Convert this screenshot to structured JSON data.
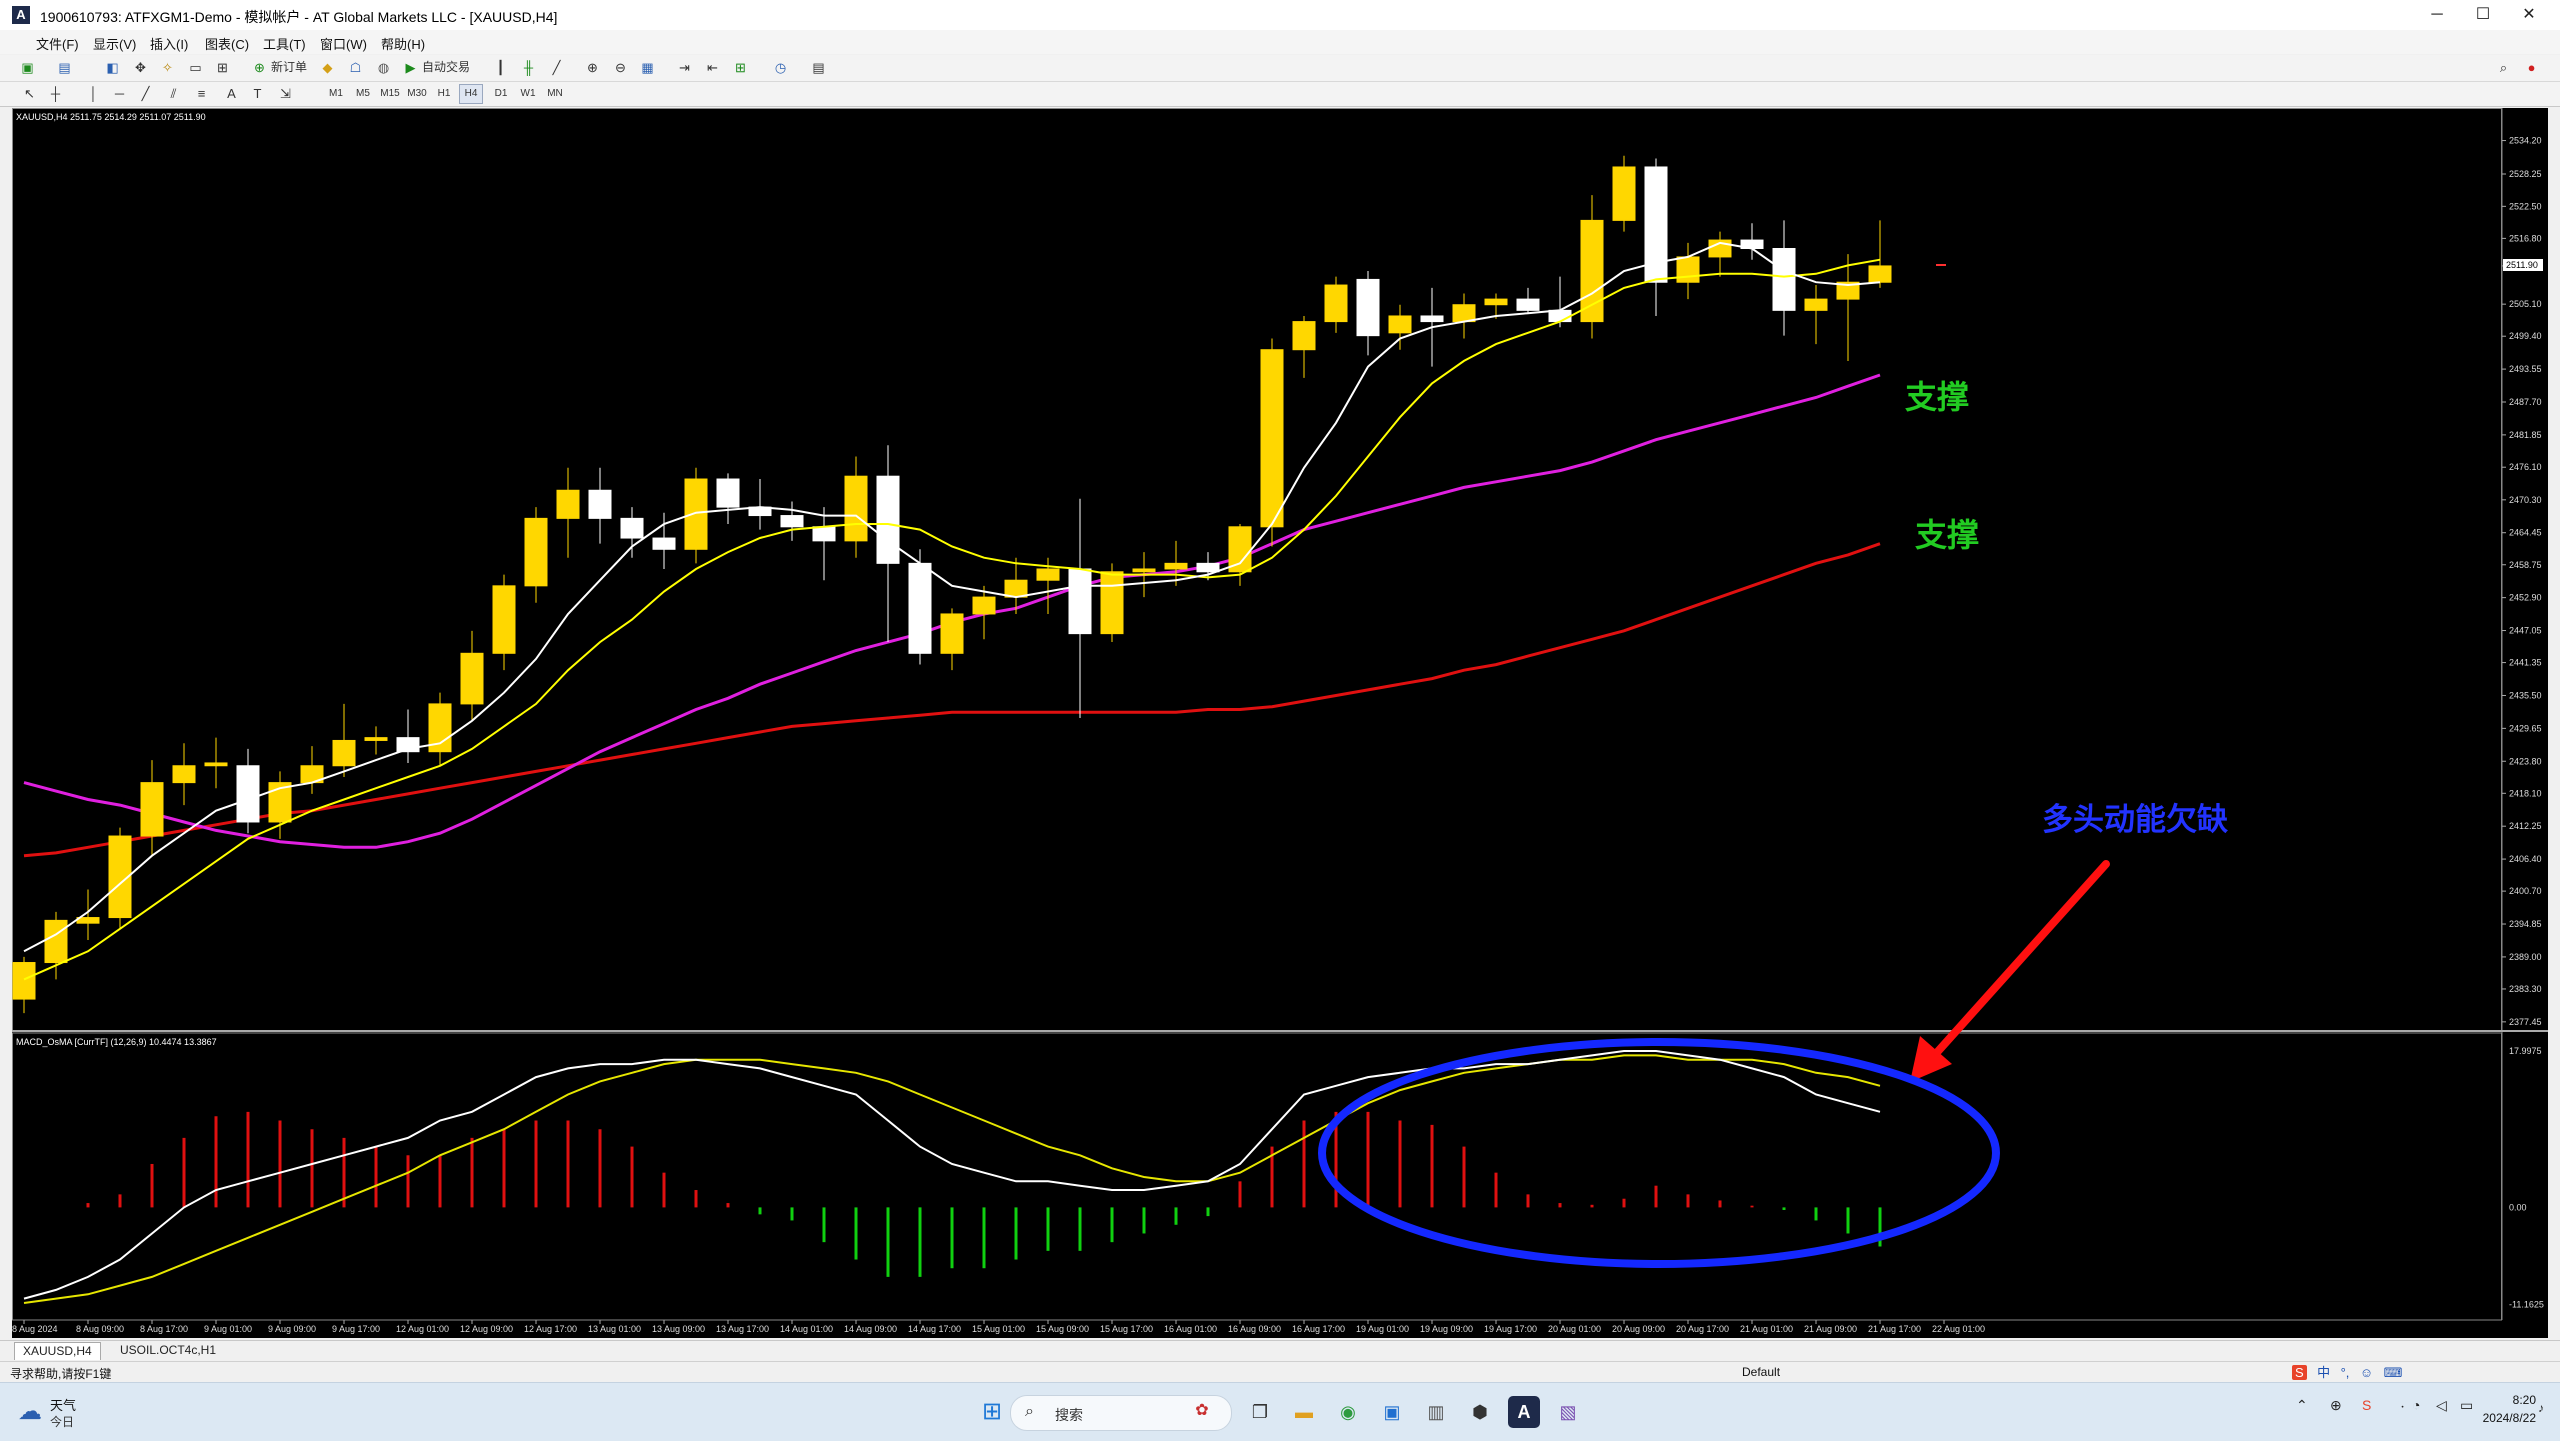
{
  "window": {
    "title": "1900610793: ATFXGM1-Demo - 模拟帐户 - AT Global Markets LLC - [XAUUSD,H4]",
    "minimize": "─",
    "maximize": "☐",
    "close": "✕"
  },
  "menu": [
    "文件(F)",
    "显示(V)",
    "插入(I)",
    "图表(C)",
    "工具(T)",
    "窗口(W)",
    "帮助(H)"
  ],
  "toolbar": {
    "new_order": "新订单",
    "auto_trading": "自动交易"
  },
  "timeframes": [
    "M1",
    "M5",
    "M15",
    "M30",
    "H1",
    "H4",
    "D1",
    "W1",
    "MN"
  ],
  "active_timeframe": "H4",
  "chart_header": "XAUUSD,H4  2511.75 2514.29 2511.07 2511.90",
  "current_price_label": "2511.90",
  "indicator_header": "MACD_OsMA [CurrTF] (12,26,9) 10.4474 13.3867",
  "annotations": {
    "support_1": "支撑",
    "support_2": "支撑",
    "momentum_text": "多头动能欠缺"
  },
  "colors": {
    "bull_candle": "#ffd700",
    "bear_candle": "#ffffff",
    "ma_fast": "#ffffff",
    "ma_slow": "#ffff00",
    "ma_magenta": "#e020e0",
    "ma_red": "#e01010",
    "annotation_green": "#22cc22",
    "annotation_blue": "#2233ff",
    "macd_pos": "#e01010",
    "macd_neg": "#10d010"
  },
  "tabs": [
    "XAUUSD,H4",
    "USOIL.OCT4c,H1"
  ],
  "status": {
    "help": "寻求帮助,请按F1键",
    "profile": "Default"
  },
  "taskbar": {
    "weather": "天气",
    "weather_sub": "今日",
    "search_placeholder": "搜索",
    "time": "8:20",
    "date": "2024/8/22"
  },
  "ime": [
    "S",
    "中",
    "°,",
    "☺",
    "⌨"
  ],
  "chart_data": {
    "type": "candlestick",
    "symbol": "XAUUSD",
    "timeframe": "H4",
    "price_ticks": [
      2534.2,
      2528.25,
      2522.5,
      2516.8,
      2511.9,
      2505.1,
      2499.4,
      2493.55,
      2487.7,
      2481.85,
      2476.1,
      2470.3,
      2464.45,
      2458.75,
      2452.9,
      2447.05,
      2441.35,
      2435.5,
      2429.65,
      2423.8,
      2418.1,
      2412.25,
      2406.4,
      2400.7,
      2394.85,
      2389.0,
      2383.3,
      2377.45
    ],
    "ylim": [
      2376.0,
      2537.5
    ],
    "macd_ticks": [
      "17.9975",
      "0.00",
      "-11.1625"
    ],
    "macd_ylim": [
      -12.5,
      19.5
    ],
    "time_labels": [
      "8 Aug 2024",
      "8 Aug 09:00",
      "8 Aug 17:00",
      "9 Aug 01:00",
      "9 Aug 09:00",
      "9 Aug 17:00",
      "12 Aug 01:00",
      "12 Aug 09:00",
      "12 Aug 17:00",
      "13 Aug 01:00",
      "13 Aug 09:00",
      "13 Aug 17:00",
      "14 Aug 01:00",
      "14 Aug 09:00",
      "14 Aug 17:00",
      "15 Aug 01:00",
      "15 Aug 09:00",
      "15 Aug 17:00",
      "16 Aug 01:00",
      "16 Aug 09:00",
      "16 Aug 17:00",
      "19 Aug 01:00",
      "19 Aug 09:00",
      "19 Aug 17:00",
      "20 Aug 01:00",
      "20 Aug 09:00",
      "20 Aug 17:00",
      "21 Aug 01:00",
      "21 Aug 09:00",
      "21 Aug 17:00",
      "22 Aug 01:00"
    ],
    "candles": [
      {
        "o": 2381.5,
        "h": 2389.0,
        "l": 2379.0,
        "c": 2388.0
      },
      {
        "o": 2388.0,
        "h": 2397.0,
        "l": 2385.0,
        "c": 2395.5
      },
      {
        "o": 2395.0,
        "h": 2401.0,
        "l": 2392.0,
        "c": 2396.0
      },
      {
        "o": 2396.0,
        "h": 2412.0,
        "l": 2394.0,
        "c": 2410.5
      },
      {
        "o": 2410.5,
        "h": 2424.0,
        "l": 2407.0,
        "c": 2420.0
      },
      {
        "o": 2420.0,
        "h": 2427.0,
        "l": 2416.0,
        "c": 2423.0
      },
      {
        "o": 2423.0,
        "h": 2428.0,
        "l": 2419.0,
        "c": 2423.5
      },
      {
        "o": 2423.0,
        "h": 2426.0,
        "l": 2411.0,
        "c": 2413.0
      },
      {
        "o": 2413.0,
        "h": 2422.0,
        "l": 2410.0,
        "c": 2420.0
      },
      {
        "o": 2420.0,
        "h": 2426.5,
        "l": 2418.0,
        "c": 2423.0
      },
      {
        "o": 2423.0,
        "h": 2434.0,
        "l": 2421.0,
        "c": 2427.5
      },
      {
        "o": 2427.5,
        "h": 2430.0,
        "l": 2425.0,
        "c": 2428.0
      },
      {
        "o": 2428.0,
        "h": 2433.0,
        "l": 2423.5,
        "c": 2425.5
      },
      {
        "o": 2425.5,
        "h": 2436.0,
        "l": 2423.0,
        "c": 2434.0
      },
      {
        "o": 2434.0,
        "h": 2447.0,
        "l": 2431.0,
        "c": 2443.0
      },
      {
        "o": 2443.0,
        "h": 2457.0,
        "l": 2440.0,
        "c": 2455.0
      },
      {
        "o": 2455.0,
        "h": 2469.0,
        "l": 2452.0,
        "c": 2467.0
      },
      {
        "o": 2467.0,
        "h": 2476.0,
        "l": 2460.0,
        "c": 2472.0
      },
      {
        "o": 2472.0,
        "h": 2476.0,
        "l": 2462.5,
        "c": 2467.0
      },
      {
        "o": 2467.0,
        "h": 2469.0,
        "l": 2460.0,
        "c": 2463.5
      },
      {
        "o": 2463.5,
        "h": 2468.0,
        "l": 2458.0,
        "c": 2461.5
      },
      {
        "o": 2461.5,
        "h": 2476.0,
        "l": 2459.0,
        "c": 2474.0
      },
      {
        "o": 2474.0,
        "h": 2475.0,
        "l": 2466.0,
        "c": 2469.0
      },
      {
        "o": 2469.0,
        "h": 2474.0,
        "l": 2465.0,
        "c": 2467.5
      },
      {
        "o": 2467.5,
        "h": 2470.0,
        "l": 2463.0,
        "c": 2465.5
      },
      {
        "o": 2465.5,
        "h": 2469.0,
        "l": 2456.0,
        "c": 2463.0
      },
      {
        "o": 2463.0,
        "h": 2478.0,
        "l": 2460.0,
        "c": 2474.5
      },
      {
        "o": 2474.5,
        "h": 2480.0,
        "l": 2445.0,
        "c": 2459.0
      },
      {
        "o": 2459.0,
        "h": 2461.5,
        "l": 2441.0,
        "c": 2443.0
      },
      {
        "o": 2443.0,
        "h": 2451.0,
        "l": 2440.0,
        "c": 2450.0
      },
      {
        "o": 2450.0,
        "h": 2455.0,
        "l": 2445.5,
        "c": 2453.0
      },
      {
        "o": 2453.0,
        "h": 2460.0,
        "l": 2450.0,
        "c": 2456.0
      },
      {
        "o": 2456.0,
        "h": 2460.0,
        "l": 2450.0,
        "c": 2458.0
      },
      {
        "o": 2458.0,
        "h": 2470.5,
        "l": 2431.5,
        "c": 2446.5
      },
      {
        "o": 2446.5,
        "h": 2459.0,
        "l": 2445.0,
        "c": 2457.5
      },
      {
        "o": 2457.5,
        "h": 2461.0,
        "l": 2453.0,
        "c": 2458.0
      },
      {
        "o": 2458.0,
        "h": 2463.0,
        "l": 2455.0,
        "c": 2459.0
      },
      {
        "o": 2459.0,
        "h": 2461.0,
        "l": 2456.0,
        "c": 2457.5
      },
      {
        "o": 2457.5,
        "h": 2466.0,
        "l": 2455.0,
        "c": 2465.5
      },
      {
        "o": 2465.5,
        "h": 2499.0,
        "l": 2462.0,
        "c": 2497.0
      },
      {
        "o": 2497.0,
        "h": 2503.0,
        "l": 2492.0,
        "c": 2502.0
      },
      {
        "o": 2502.0,
        "h": 2510.0,
        "l": 2500.0,
        "c": 2508.5
      },
      {
        "o": 2509.5,
        "h": 2511.0,
        "l": 2496.0,
        "c": 2499.5
      },
      {
        "o": 2500.0,
        "h": 2505.0,
        "l": 2497.0,
        "c": 2503.0
      },
      {
        "o": 2503.0,
        "h": 2508.0,
        "l": 2494.0,
        "c": 2502.0
      },
      {
        "o": 2502.0,
        "h": 2507.0,
        "l": 2499.0,
        "c": 2505.0
      },
      {
        "o": 2505.0,
        "h": 2507.0,
        "l": 2502.5,
        "c": 2506.0
      },
      {
        "o": 2506.0,
        "h": 2508.0,
        "l": 2503.5,
        "c": 2504.0
      },
      {
        "o": 2504.0,
        "h": 2510.0,
        "l": 2501.0,
        "c": 2502.0
      },
      {
        "o": 2502.0,
        "h": 2524.5,
        "l": 2499.0,
        "c": 2520.0
      },
      {
        "o": 2520.0,
        "h": 2531.5,
        "l": 2518.0,
        "c": 2529.5
      },
      {
        "o": 2529.5,
        "h": 2531.0,
        "l": 2503.0,
        "c": 2509.0
      },
      {
        "o": 2509.0,
        "h": 2516.0,
        "l": 2506.0,
        "c": 2513.5
      },
      {
        "o": 2513.5,
        "h": 2518.0,
        "l": 2510.0,
        "c": 2516.5
      },
      {
        "o": 2516.5,
        "h": 2519.5,
        "l": 2513.0,
        "c": 2515.0
      },
      {
        "o": 2515.0,
        "h": 2520.0,
        "l": 2499.5,
        "c": 2504.0
      },
      {
        "o": 2504.0,
        "h": 2508.5,
        "l": 2498.0,
        "c": 2506.0
      },
      {
        "o": 2506.0,
        "h": 2514.0,
        "l": 2495.0,
        "c": 2509.0
      },
      {
        "o": 2509.0,
        "h": 2520.0,
        "l": 2508.0,
        "c": 2511.9
      }
    ],
    "ma_fast": [
      2390,
      2393,
      2397,
      2402,
      2407,
      2411,
      2415,
      2417,
      2419,
      2420,
      2422,
      2424,
      2426,
      2427,
      2431,
      2436,
      2442,
      2450,
      2456,
      2462,
      2466,
      2468,
      2468.5,
      2469,
      2468.5,
      2467.5,
      2467.5,
      2463,
      2459,
      2455,
      2454,
      2453,
      2454,
      2455,
      2455,
      2455.5,
      2456,
      2457,
      2459,
      2466,
      2476,
      2484,
      2494,
      2499,
      2501,
      2502,
      2503,
      2503.5,
      2504,
      2507,
      2511,
      2512.5,
      2513.5,
      2516,
      2515,
      2511,
      2509,
      2508.5,
      2509
    ],
    "ma_slow": [
      2385,
      2387.5,
      2390,
      2394,
      2398,
      2402,
      2406,
      2410,
      2412.5,
      2415,
      2417,
      2419,
      2421,
      2423,
      2426,
      2430,
      2434,
      2440,
      2445,
      2449,
      2454,
      2458,
      2461,
      2463.5,
      2465,
      2465.5,
      2466,
      2466,
      2465,
      2462,
      2460,
      2459,
      2458.5,
      2458,
      2457,
      2457,
      2457,
      2456.5,
      2457,
      2460,
      2465,
      2471,
      2478,
      2485,
      2491,
      2495,
      2498,
      2500,
      2502,
      2505,
      2508,
      2509.5,
      2510,
      2510.5,
      2510.5,
      2510,
      2510.5,
      2512,
      2513
    ],
    "ma_magenta": [
      2420.0,
      2418.5,
      2417.0,
      2416.0,
      2414.5,
      2413.0,
      2411.5,
      2410.5,
      2409.5,
      2409.0,
      2408.5,
      2408.5,
      2409.5,
      2411.0,
      2413.5,
      2416.5,
      2419.5,
      2422.5,
      2425.5,
      2428.0,
      2430.5,
      2433.0,
      2435.0,
      2437.5,
      2439.5,
      2441.5,
      2443.5,
      2445.0,
      2446.5,
      2448.5,
      2450.0,
      2451.0,
      2453.0,
      2455.0,
      2456.5,
      2457.0,
      2457.5,
      2458.5,
      2460.0,
      2462.5,
      2465.0,
      2466.5,
      2468.0,
      2469.5,
      2471.0,
      2472.5,
      2473.5,
      2474.5,
      2475.5,
      2477.0,
      2479.0,
      2481.0,
      2482.5,
      2484.0,
      2485.5,
      2487.0,
      2488.5,
      2490.5,
      2492.5
    ],
    "ma_red": [
      2407.0,
      2407.5,
      2408.5,
      2409.5,
      2410.5,
      2411.5,
      2412.5,
      2413.5,
      2414.5,
      2415.0,
      2416.0,
      2417.0,
      2418.0,
      2419.0,
      2420.0,
      2421.0,
      2422.0,
      2423.0,
      2424.0,
      2425.0,
      2426.0,
      2427.0,
      2428.0,
      2429.0,
      2430.0,
      2430.5,
      2431.0,
      2431.5,
      2432.0,
      2432.5,
      2432.5,
      2432.5,
      2432.5,
      2432.5,
      2432.5,
      2432.5,
      2432.5,
      2433.0,
      2433.0,
      2433.5,
      2434.5,
      2435.5,
      2436.5,
      2437.5,
      2438.5,
      2440.0,
      2441.0,
      2442.5,
      2444.0,
      2445.5,
      2447.0,
      2449.0,
      2451.0,
      2453.0,
      2455.0,
      2457.0,
      2459.0,
      2460.5,
      2462.5
    ],
    "macd_hist": [
      0,
      0,
      0.5,
      1.5,
      5,
      8,
      10.5,
      11,
      10,
      9,
      8,
      7,
      6,
      6,
      8,
      9,
      10,
      10,
      9,
      7,
      4,
      2,
      0.5,
      -0.8,
      -1.5,
      -4,
      -6,
      -8,
      -8,
      -7,
      -7,
      -6,
      -5,
      -5,
      -4,
      -3,
      -2,
      -1,
      3,
      7,
      10,
      11,
      11,
      10,
      9.5,
      7,
      4,
      1.5,
      0.5,
      0.3,
      1,
      2.5,
      1.5,
      0.8,
      0.2,
      -0.3,
      -1.5,
      -3,
      -4.5
    ],
    "macd_line": [
      -10.5,
      -9.5,
      -8,
      -6,
      -3,
      0,
      2,
      3,
      4,
      5,
      6,
      7,
      8,
      10,
      11,
      13,
      15,
      16,
      16.5,
      16.5,
      17,
      17,
      16.5,
      16,
      15,
      14,
      13,
      10,
      7,
      5,
      4,
      3,
      3,
      2.5,
      2,
      2,
      2.5,
      3,
      5,
      9,
      13,
      14,
      15,
      15.5,
      16,
      16,
      16.5,
      16.5,
      17,
      17.5,
      18,
      18,
      17.5,
      17,
      16,
      15,
      13,
      12,
      11
    ],
    "macd_signal": [
      -11,
      -10.5,
      -10,
      -9,
      -8,
      -6.5,
      -5,
      -3.5,
      -2,
      -0.5,
      1,
      2.5,
      4,
      6,
      7.5,
      9,
      11,
      13,
      14.5,
      15.5,
      16.5,
      17,
      17,
      17,
      16.5,
      16,
      15.5,
      14.5,
      13,
      11.5,
      10,
      8.5,
      7,
      6,
      4.5,
      3.5,
      3,
      3,
      4,
      6,
      8,
      10,
      12,
      13.5,
      14.5,
      15.5,
      16,
      16.5,
      17,
      17,
      17.5,
      17.5,
      17,
      17,
      17,
      16.5,
      15.5,
      15,
      14
    ]
  }
}
